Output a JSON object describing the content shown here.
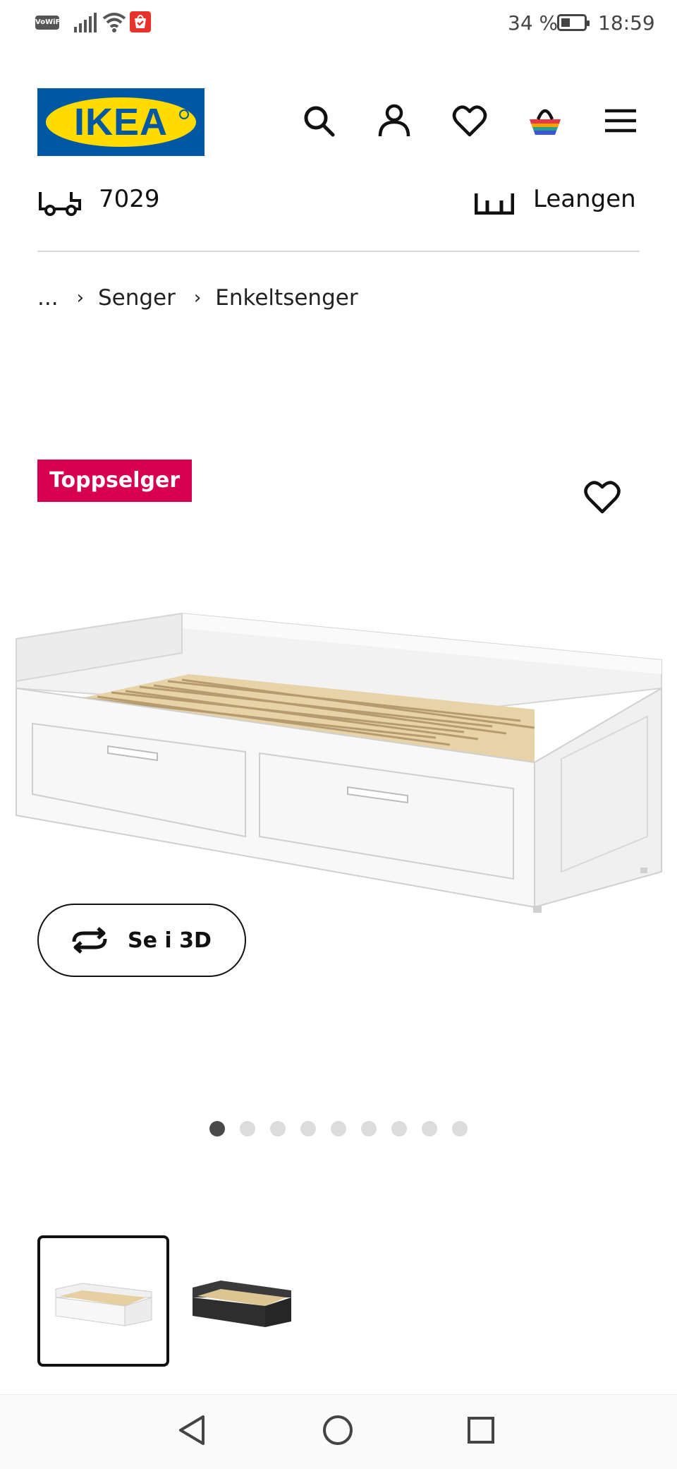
{
  "status_bar": {
    "network_label": "VoWiFi",
    "battery_percent": "34 %",
    "time": "18:59"
  },
  "header": {
    "logo_text": "IKEA",
    "icons": [
      "search-icon",
      "account-icon",
      "favorites-icon",
      "cart-icon",
      "menu-icon"
    ]
  },
  "info_strip": {
    "postal_code": "7029",
    "store_name": "Leangen"
  },
  "breadcrumb": {
    "items": [
      "...",
      "Senger",
      "Enkeltsenger"
    ]
  },
  "product": {
    "badge": "Toppselger",
    "view_3d_label": "Se i 3D",
    "carousel": {
      "total": 9,
      "active_index": 0
    },
    "thumbnails": [
      {
        "variant": "white",
        "selected": true
      },
      {
        "variant": "black",
        "selected": false
      }
    ]
  },
  "colors": {
    "ikea_blue": "#0058a3",
    "ikea_yellow": "#ffdb00",
    "badge": "#d6004e",
    "text": "#111111"
  }
}
